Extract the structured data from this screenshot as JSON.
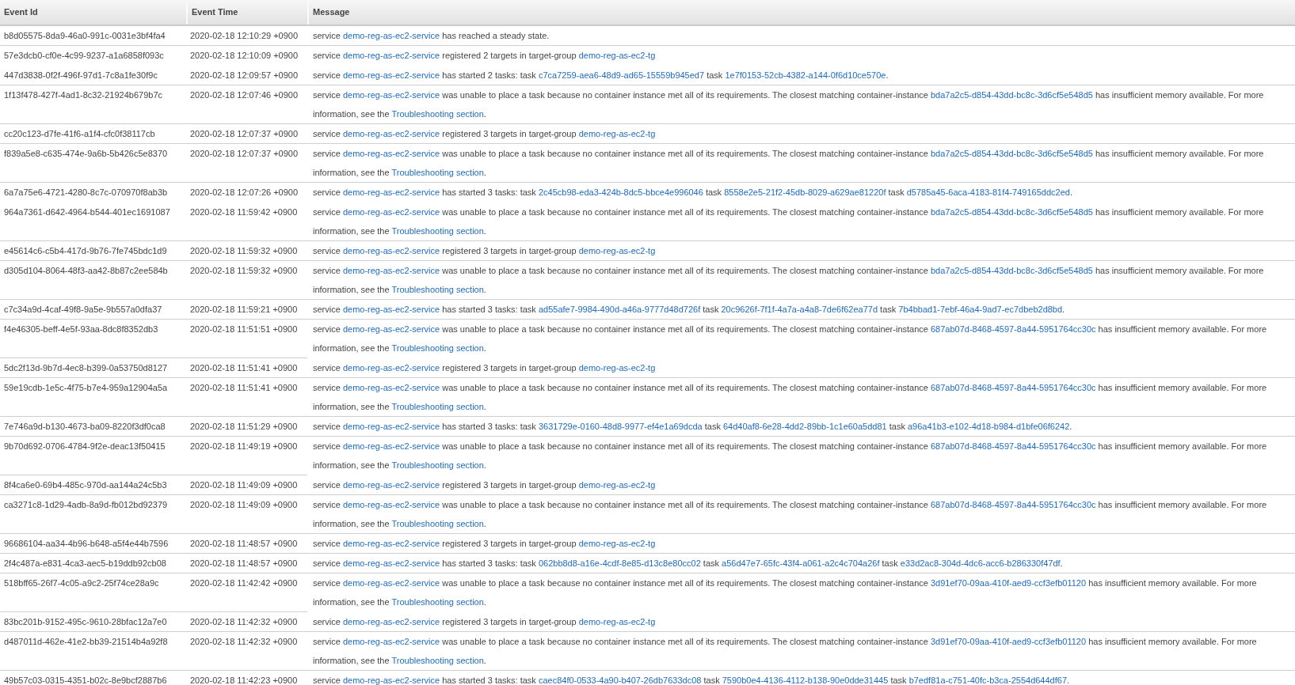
{
  "table": {
    "columns": [
      "Event Id",
      "Event Time",
      "Message"
    ],
    "rows": [
      {
        "divider_above": true,
        "divider_across_message": true,
        "id": "b8d05575-8da9-46a0-991c-0031e3bf4fa4",
        "time": "2020-02-18 12:10:29 +0900",
        "message": [
          {
            "kind": "text",
            "text": "service "
          },
          {
            "kind": "link",
            "text": "demo-reg-as-ec2-service"
          },
          {
            "kind": "text",
            "text": " has reached a steady state."
          }
        ]
      },
      {
        "divider_above": true,
        "divider_across_message": true,
        "id": "57e3dcb0-cf0e-4c99-9237-a1a6858f093c",
        "time": "2020-02-18 12:10:09 +0900",
        "message": [
          {
            "kind": "text",
            "text": "service "
          },
          {
            "kind": "link",
            "text": "demo-reg-as-ec2-service"
          },
          {
            "kind": "text",
            "text": " registered 2 targets in target-group "
          },
          {
            "kind": "link",
            "text": "demo-reg-as-ec2-tg"
          }
        ]
      },
      {
        "divider_above": false,
        "divider_across_message": false,
        "id": "447d3838-0f2f-496f-97d1-7c8a1fe30f9c",
        "time": "2020-02-18 12:09:57 +0900",
        "message": [
          {
            "kind": "text",
            "text": "service "
          },
          {
            "kind": "link",
            "text": "demo-reg-as-ec2-service"
          },
          {
            "kind": "text",
            "text": " has started 2 tasks: task "
          },
          {
            "kind": "link",
            "text": "c7ca7259-aea6-48d9-ad65-15559b945ed7"
          },
          {
            "kind": "text",
            "text": " task "
          },
          {
            "kind": "link",
            "text": "1e7f0153-52cb-4382-a144-0f6d10ce570e"
          },
          {
            "kind": "text",
            "text": "."
          }
        ]
      },
      {
        "divider_above": true,
        "divider_across_message": true,
        "id": "1f13f478-427f-4ad1-8c32-21924b679b7c",
        "time": "2020-02-18 12:07:46 +0900",
        "message": [
          {
            "kind": "text",
            "text": "service "
          },
          {
            "kind": "link",
            "text": "demo-reg-as-ec2-service"
          },
          {
            "kind": "text",
            "text": " was unable to place a task because no container instance met all of its requirements. The closest matching container-instance "
          },
          {
            "kind": "link",
            "text": "bda7a2c5-d854-43dd-bc8c-3d6cf5e548d5"
          },
          {
            "kind": "text",
            "text": " has insufficient memory available. For more information, see the "
          },
          {
            "kind": "link",
            "text": "Troubleshooting section"
          },
          {
            "kind": "text",
            "text": "."
          }
        ]
      },
      {
        "divider_above": true,
        "divider_across_message": true,
        "id": "cc20c123-d7fe-41f6-a1f4-cfc0f38117cb",
        "time": "2020-02-18 12:07:37 +0900",
        "message": [
          {
            "kind": "text",
            "text": "service "
          },
          {
            "kind": "link",
            "text": "demo-reg-as-ec2-service"
          },
          {
            "kind": "text",
            "text": " registered 3 targets in target-group "
          },
          {
            "kind": "link",
            "text": "demo-reg-as-ec2-tg"
          }
        ]
      },
      {
        "divider_above": true,
        "divider_across_message": true,
        "id": "f839a5e8-c635-474e-9a6b-5b426c5e8370",
        "time": "2020-02-18 12:07:37 +0900",
        "message": [
          {
            "kind": "text",
            "text": "service "
          },
          {
            "kind": "link",
            "text": "demo-reg-as-ec2-service"
          },
          {
            "kind": "text",
            "text": " was unable to place a task because no container instance met all of its requirements. The closest matching container-instance "
          },
          {
            "kind": "link",
            "text": "bda7a2c5-d854-43dd-bc8c-3d6cf5e548d5"
          },
          {
            "kind": "text",
            "text": " has insufficient memory available. For more information, see the "
          },
          {
            "kind": "link",
            "text": "Troubleshooting section"
          },
          {
            "kind": "text",
            "text": "."
          }
        ]
      },
      {
        "divider_above": true,
        "divider_across_message": true,
        "id": "6a7a75e6-4721-4280-8c7c-070970f8ab3b",
        "time": "2020-02-18 12:07:26 +0900",
        "message": [
          {
            "kind": "text",
            "text": "service "
          },
          {
            "kind": "link",
            "text": "demo-reg-as-ec2-service"
          },
          {
            "kind": "text",
            "text": " has started 3 tasks: task "
          },
          {
            "kind": "link",
            "text": "2c45cb98-eda3-424b-8dc5-bbce4e996046"
          },
          {
            "kind": "text",
            "text": " task "
          },
          {
            "kind": "link",
            "text": "8558e2e5-21f2-45db-8029-a629ae81220f"
          },
          {
            "kind": "text",
            "text": " task "
          },
          {
            "kind": "link",
            "text": "d5785a45-6aca-4183-81f4-749165ddc2ed"
          },
          {
            "kind": "text",
            "text": "."
          }
        ]
      },
      {
        "divider_above": false,
        "divider_across_message": false,
        "id": "964a7361-d642-4964-b544-401ec1691087",
        "time": "2020-02-18 11:59:42 +0900",
        "message": [
          {
            "kind": "text",
            "text": "service "
          },
          {
            "kind": "link",
            "text": "demo-reg-as-ec2-service"
          },
          {
            "kind": "text",
            "text": " was unable to place a task because no container instance met all of its requirements. The closest matching container-instance "
          },
          {
            "kind": "link",
            "text": "bda7a2c5-d854-43dd-bc8c-3d6cf5e548d5"
          },
          {
            "kind": "text",
            "text": " has insufficient memory available. For more information, see the "
          },
          {
            "kind": "link",
            "text": "Troubleshooting section"
          },
          {
            "kind": "text",
            "text": "."
          }
        ]
      },
      {
        "divider_above": true,
        "divider_across_message": true,
        "id": "e45614c6-c5b4-417d-9b76-7fe745bdc1d9",
        "time": "2020-02-18 11:59:32 +0900",
        "message": [
          {
            "kind": "text",
            "text": "service "
          },
          {
            "kind": "link",
            "text": "demo-reg-as-ec2-service"
          },
          {
            "kind": "text",
            "text": " registered 3 targets in target-group "
          },
          {
            "kind": "link",
            "text": "demo-reg-as-ec2-tg"
          }
        ]
      },
      {
        "divider_above": true,
        "divider_across_message": true,
        "id": "d305d104-8064-48f3-aa42-8b87c2ee584b",
        "time": "2020-02-18 11:59:32 +0900",
        "message": [
          {
            "kind": "text",
            "text": "service "
          },
          {
            "kind": "link",
            "text": "demo-reg-as-ec2-service"
          },
          {
            "kind": "text",
            "text": " was unable to place a task because no container instance met all of its requirements. The closest matching container-instance "
          },
          {
            "kind": "link",
            "text": "bda7a2c5-d854-43dd-bc8c-3d6cf5e548d5"
          },
          {
            "kind": "text",
            "text": " has insufficient memory available. For more information, see the "
          },
          {
            "kind": "link",
            "text": "Troubleshooting section"
          },
          {
            "kind": "text",
            "text": "."
          }
        ]
      },
      {
        "divider_above": true,
        "divider_across_message": true,
        "id": "c7c34a9d-4caf-49f8-9a5e-9b557a0dfa37",
        "time": "2020-02-18 11:59:21 +0900",
        "message": [
          {
            "kind": "text",
            "text": "service "
          },
          {
            "kind": "link",
            "text": "demo-reg-as-ec2-service"
          },
          {
            "kind": "text",
            "text": " has started 3 tasks: task "
          },
          {
            "kind": "link",
            "text": "ad55afe7-9984-490d-a46a-9777d48d726f"
          },
          {
            "kind": "text",
            "text": " task "
          },
          {
            "kind": "link",
            "text": "20c9626f-7f1f-4a7a-a4a8-7de6f62ea77d"
          },
          {
            "kind": "text",
            "text": " task "
          },
          {
            "kind": "link",
            "text": "7b4bbad1-7ebf-46a4-9ad7-ec7dbeb2d8bd"
          },
          {
            "kind": "text",
            "text": "."
          }
        ]
      },
      {
        "divider_above": true,
        "divider_across_message": true,
        "id": "f4e46305-beff-4e5f-93aa-8dc8f8352db3",
        "time": "2020-02-18 11:51:51 +0900",
        "message": [
          {
            "kind": "text",
            "text": "service "
          },
          {
            "kind": "link",
            "text": "demo-reg-as-ec2-service"
          },
          {
            "kind": "text",
            "text": " was unable to place a task because no container instance met all of its requirements. The closest matching container-instance "
          },
          {
            "kind": "link",
            "text": "687ab07d-8468-4597-8a44-5951764cc30c"
          },
          {
            "kind": "text",
            "text": " has insufficient memory available. For more information, see the "
          },
          {
            "kind": "link",
            "text": "Troubleshooting section"
          },
          {
            "kind": "text",
            "text": "."
          }
        ]
      },
      {
        "divider_above": true,
        "divider_across_message": false,
        "id": "5dc2f13d-9b7d-4ec8-b399-0a53750d8127",
        "time": "2020-02-18 11:51:41 +0900",
        "message": [
          {
            "kind": "text",
            "text": "service "
          },
          {
            "kind": "link",
            "text": "demo-reg-as-ec2-service"
          },
          {
            "kind": "text",
            "text": " registered 3 targets in target-group "
          },
          {
            "kind": "link",
            "text": "demo-reg-as-ec2-tg"
          }
        ]
      },
      {
        "divider_above": true,
        "divider_across_message": true,
        "id": "59e19cdb-1e5c-4f75-b7e4-959a12904a5a",
        "time": "2020-02-18 11:51:41 +0900",
        "message": [
          {
            "kind": "text",
            "text": "service "
          },
          {
            "kind": "link",
            "text": "demo-reg-as-ec2-service"
          },
          {
            "kind": "text",
            "text": " was unable to place a task because no container instance met all of its requirements. The closest matching container-instance "
          },
          {
            "kind": "link",
            "text": "687ab07d-8468-4597-8a44-5951764cc30c"
          },
          {
            "kind": "text",
            "text": " has insufficient memory available. For more information, see the "
          },
          {
            "kind": "link",
            "text": "Troubleshooting section"
          },
          {
            "kind": "text",
            "text": "."
          }
        ]
      },
      {
        "divider_above": true,
        "divider_across_message": true,
        "id": "7e746a9d-b130-4673-ba09-8220f3df0ca8",
        "time": "2020-02-18 11:51:29 +0900",
        "message": [
          {
            "kind": "text",
            "text": "service "
          },
          {
            "kind": "link",
            "text": "demo-reg-as-ec2-service"
          },
          {
            "kind": "text",
            "text": " has started 3 tasks: task "
          },
          {
            "kind": "link",
            "text": "3631729e-0160-48d8-9977-ef4e1a69dcda"
          },
          {
            "kind": "text",
            "text": " task "
          },
          {
            "kind": "link",
            "text": "64d40af8-6e28-4dd2-89bb-1c1e60a5dd81"
          },
          {
            "kind": "text",
            "text": " task "
          },
          {
            "kind": "link",
            "text": "a96a41b3-e102-4d18-b984-d1bfe06f6242"
          },
          {
            "kind": "text",
            "text": "."
          }
        ]
      },
      {
        "divider_above": true,
        "divider_across_message": true,
        "id": "9b70d692-0706-4784-9f2e-deac13f50415",
        "time": "2020-02-18 11:49:19 +0900",
        "message": [
          {
            "kind": "text",
            "text": "service "
          },
          {
            "kind": "link",
            "text": "demo-reg-as-ec2-service"
          },
          {
            "kind": "text",
            "text": " was unable to place a task because no container instance met all of its requirements. The closest matching container-instance "
          },
          {
            "kind": "link",
            "text": "687ab07d-8468-4597-8a44-5951764cc30c"
          },
          {
            "kind": "text",
            "text": " has insufficient memory available. For more information, see the "
          },
          {
            "kind": "link",
            "text": "Troubleshooting section"
          },
          {
            "kind": "text",
            "text": "."
          }
        ]
      },
      {
        "divider_above": true,
        "divider_across_message": false,
        "id": "8f4ca6e0-69b4-485c-970d-aa144a24c5b3",
        "time": "2020-02-18 11:49:09 +0900",
        "message": [
          {
            "kind": "text",
            "text": "service "
          },
          {
            "kind": "link",
            "text": "demo-reg-as-ec2-service"
          },
          {
            "kind": "text",
            "text": " registered 3 targets in target-group "
          },
          {
            "kind": "link",
            "text": "demo-reg-as-ec2-tg"
          }
        ]
      },
      {
        "divider_above": true,
        "divider_across_message": true,
        "id": "ca3271c8-1d29-4adb-8a9d-fb012bd92379",
        "time": "2020-02-18 11:49:09 +0900",
        "message": [
          {
            "kind": "text",
            "text": "service "
          },
          {
            "kind": "link",
            "text": "demo-reg-as-ec2-service"
          },
          {
            "kind": "text",
            "text": " was unable to place a task because no container instance met all of its requirements. The closest matching container-instance "
          },
          {
            "kind": "link",
            "text": "687ab07d-8468-4597-8a44-5951764cc30c"
          },
          {
            "kind": "text",
            "text": " has insufficient memory available. For more information, see the "
          },
          {
            "kind": "link",
            "text": "Troubleshooting section"
          },
          {
            "kind": "text",
            "text": "."
          }
        ]
      },
      {
        "divider_above": true,
        "divider_across_message": true,
        "id": "96686104-aa34-4b96-b648-a5f4e44b7596",
        "time": "2020-02-18 11:48:57 +0900",
        "message": [
          {
            "kind": "text",
            "text": "service "
          },
          {
            "kind": "link",
            "text": "demo-reg-as-ec2-service"
          },
          {
            "kind": "text",
            "text": " registered 3 targets in target-group "
          },
          {
            "kind": "link",
            "text": "demo-reg-as-ec2-tg"
          }
        ]
      },
      {
        "divider_above": true,
        "divider_across_message": true,
        "id": "2f4c487a-e831-4ca3-aec5-b19ddb92cb08",
        "time": "2020-02-18 11:48:57 +0900",
        "message": [
          {
            "kind": "text",
            "text": "service "
          },
          {
            "kind": "link",
            "text": "demo-reg-as-ec2-service"
          },
          {
            "kind": "text",
            "text": " has started 3 tasks: task "
          },
          {
            "kind": "link",
            "text": "062bb8d8-a16e-4cdf-8e85-d13c8e80cc02"
          },
          {
            "kind": "text",
            "text": " task "
          },
          {
            "kind": "link",
            "text": "a56d47e7-65fc-43f4-a061-a2c4c704a26f"
          },
          {
            "kind": "text",
            "text": " task "
          },
          {
            "kind": "link",
            "text": "e33d2ac8-304d-4dc6-acc6-b286330f47df"
          },
          {
            "kind": "text",
            "text": "."
          }
        ]
      },
      {
        "divider_above": true,
        "divider_across_message": true,
        "id": "518bff65-26f7-4c05-a9c2-25f74ce28a9c",
        "time": "2020-02-18 11:42:42 +0900",
        "message": [
          {
            "kind": "text",
            "text": "service "
          },
          {
            "kind": "link",
            "text": "demo-reg-as-ec2-service"
          },
          {
            "kind": "text",
            "text": " was unable to place a task because no container instance met all of its requirements. The closest matching container-instance "
          },
          {
            "kind": "link",
            "text": "3d91ef70-09aa-410f-aed9-ccf3efb01120"
          },
          {
            "kind": "text",
            "text": " has insufficient memory available. For more information, see the "
          },
          {
            "kind": "link",
            "text": "Troubleshooting section"
          },
          {
            "kind": "text",
            "text": "."
          }
        ]
      },
      {
        "divider_above": true,
        "divider_across_message": false,
        "id": "83bc201b-9152-495c-9610-28bfac12a7e0",
        "time": "2020-02-18 11:42:32 +0900",
        "message": [
          {
            "kind": "text",
            "text": "service "
          },
          {
            "kind": "link",
            "text": "demo-reg-as-ec2-service"
          },
          {
            "kind": "text",
            "text": " registered 3 targets in target-group "
          },
          {
            "kind": "link",
            "text": "demo-reg-as-ec2-tg"
          }
        ]
      },
      {
        "divider_above": true,
        "divider_across_message": true,
        "id": "d487011d-462e-41e2-bb39-21514b4a92f8",
        "time": "2020-02-18 11:42:32 +0900",
        "message": [
          {
            "kind": "text",
            "text": "service "
          },
          {
            "kind": "link",
            "text": "demo-reg-as-ec2-service"
          },
          {
            "kind": "text",
            "text": " was unable to place a task because no container instance met all of its requirements. The closest matching container-instance "
          },
          {
            "kind": "link",
            "text": "3d91ef70-09aa-410f-aed9-ccf3efb01120"
          },
          {
            "kind": "text",
            "text": " has insufficient memory available. For more information, see the "
          },
          {
            "kind": "link",
            "text": "Troubleshooting section"
          },
          {
            "kind": "text",
            "text": "."
          }
        ]
      },
      {
        "divider_above": true,
        "divider_across_message": true,
        "id": "49b57c03-0315-4351-b02c-8e9bcf2887b6",
        "time": "2020-02-18 11:42:23 +0900",
        "message": [
          {
            "kind": "text",
            "text": "service "
          },
          {
            "kind": "link",
            "text": "demo-reg-as-ec2-service"
          },
          {
            "kind": "text",
            "text": " has started 3 tasks: task "
          },
          {
            "kind": "link",
            "text": "caec84f0-0533-4a90-b407-26db7633dc08"
          },
          {
            "kind": "text",
            "text": " task "
          },
          {
            "kind": "link",
            "text": "7590b0e4-4136-4112-b138-90e0dde31445"
          },
          {
            "kind": "text",
            "text": " task "
          },
          {
            "kind": "link",
            "text": "b7edf81a-c751-40fc-b3ca-2554d644df67"
          },
          {
            "kind": "text",
            "text": "."
          }
        ]
      }
    ]
  }
}
